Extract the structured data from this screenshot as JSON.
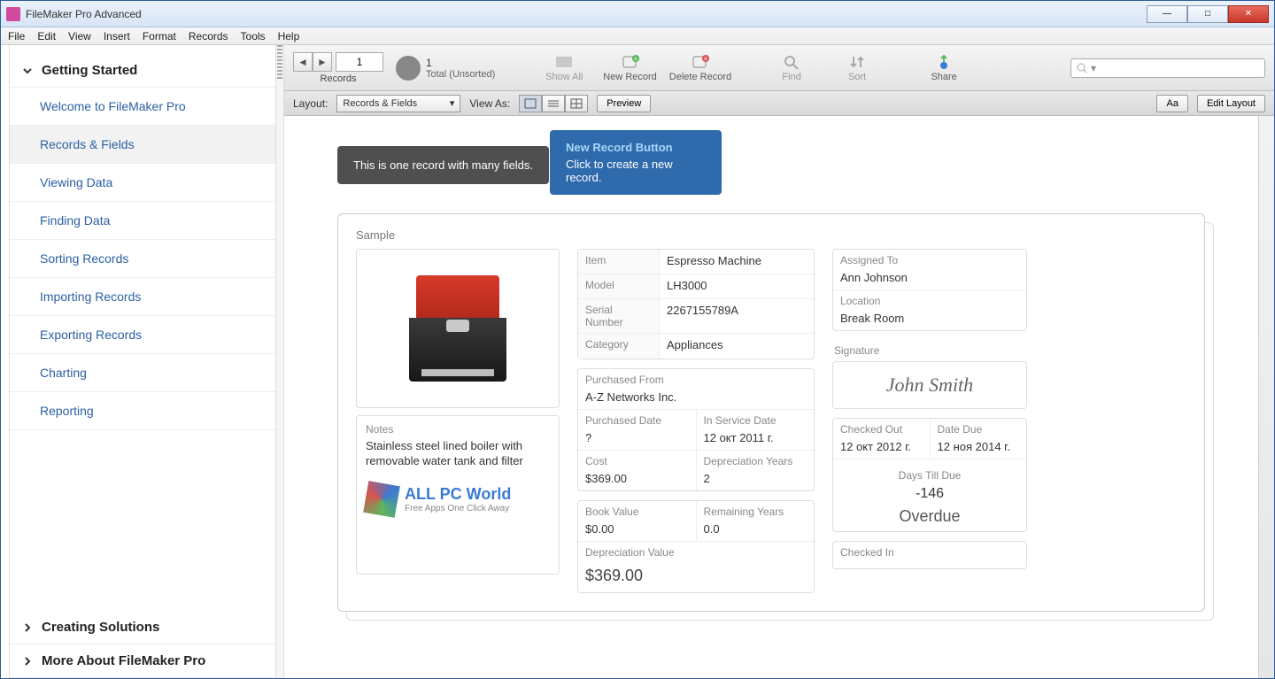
{
  "window": {
    "title": "FileMaker Pro Advanced"
  },
  "menubar": [
    "File",
    "Edit",
    "View",
    "Insert",
    "Format",
    "Records",
    "Tools",
    "Help"
  ],
  "sidebar": {
    "sections": [
      {
        "title": "Getting Started",
        "expanded": true,
        "items": [
          "Welcome to FileMaker Pro",
          "Records & Fields",
          "Viewing Data",
          "Finding Data",
          "Sorting Records",
          "Importing Records",
          "Exporting Records",
          "Charting",
          "Reporting"
        ],
        "active_index": 1
      },
      {
        "title": "Creating Solutions",
        "expanded": false,
        "items": []
      },
      {
        "title": "More About FileMaker Pro",
        "expanded": false,
        "items": []
      }
    ]
  },
  "toolbar": {
    "record_number": "1",
    "record_total": "1",
    "total_label": "Total (Unsorted)",
    "records_label": "Records",
    "buttons": {
      "show_all": "Show All",
      "new_record": "New Record",
      "delete_record": "Delete Record",
      "find": "Find",
      "sort": "Sort",
      "share": "Share"
    },
    "search_placeholder": ""
  },
  "layoutbar": {
    "layout_label": "Layout:",
    "layout_value": "Records & Fields",
    "view_as_label": "View As:",
    "preview": "Preview",
    "aa": "Aa",
    "edit_layout": "Edit Layout"
  },
  "tooltips": {
    "dark": "This is one record with many fields.",
    "blue_title": "New Record Button",
    "blue_body": "Click to create a new record."
  },
  "record": {
    "sample_label": "Sample",
    "item_lbl": "Item",
    "item": "Espresso Machine",
    "model_lbl": "Model",
    "model": "LH3000",
    "serial_lbl": "Serial Number",
    "serial": "2267155789A",
    "category_lbl": "Category",
    "category": "Appliances",
    "purchased_from_lbl": "Purchased From",
    "purchased_from": "A-Z Networks Inc.",
    "purchased_date_lbl": "Purchased Date",
    "purchased_date": "?",
    "in_service_lbl": "In Service Date",
    "in_service": "12 окт 2011 г.",
    "cost_lbl": "Cost",
    "cost": "$369.00",
    "dep_years_lbl": "Depreciation Years",
    "dep_years": "2",
    "book_value_lbl": "Book Value",
    "book_value": "$0.00",
    "remaining_lbl": "Remaining Years",
    "remaining": "0.0",
    "dep_value_lbl": "Depreciation Value",
    "dep_value": "$369.00",
    "assigned_lbl": "Assigned To",
    "assigned": "Ann Johnson",
    "location_lbl": "Location",
    "location": "Break Room",
    "signature_lbl": "Signature",
    "signature": "John Smith",
    "checked_out_lbl": "Checked Out",
    "checked_out": "12 окт 2012 г.",
    "date_due_lbl": "Date Due",
    "date_due": "12 ноя 2014 г.",
    "days_till_lbl": "Days Till Due",
    "days_till": "-146",
    "status": "Overdue",
    "checked_in_lbl": "Checked In",
    "checked_in": "",
    "notes_lbl": "Notes",
    "notes": "Stainless steel lined boiler with removable water tank and filter"
  },
  "watermark": {
    "title": "ALL PC World",
    "sub": "Free Apps One Click Away"
  }
}
